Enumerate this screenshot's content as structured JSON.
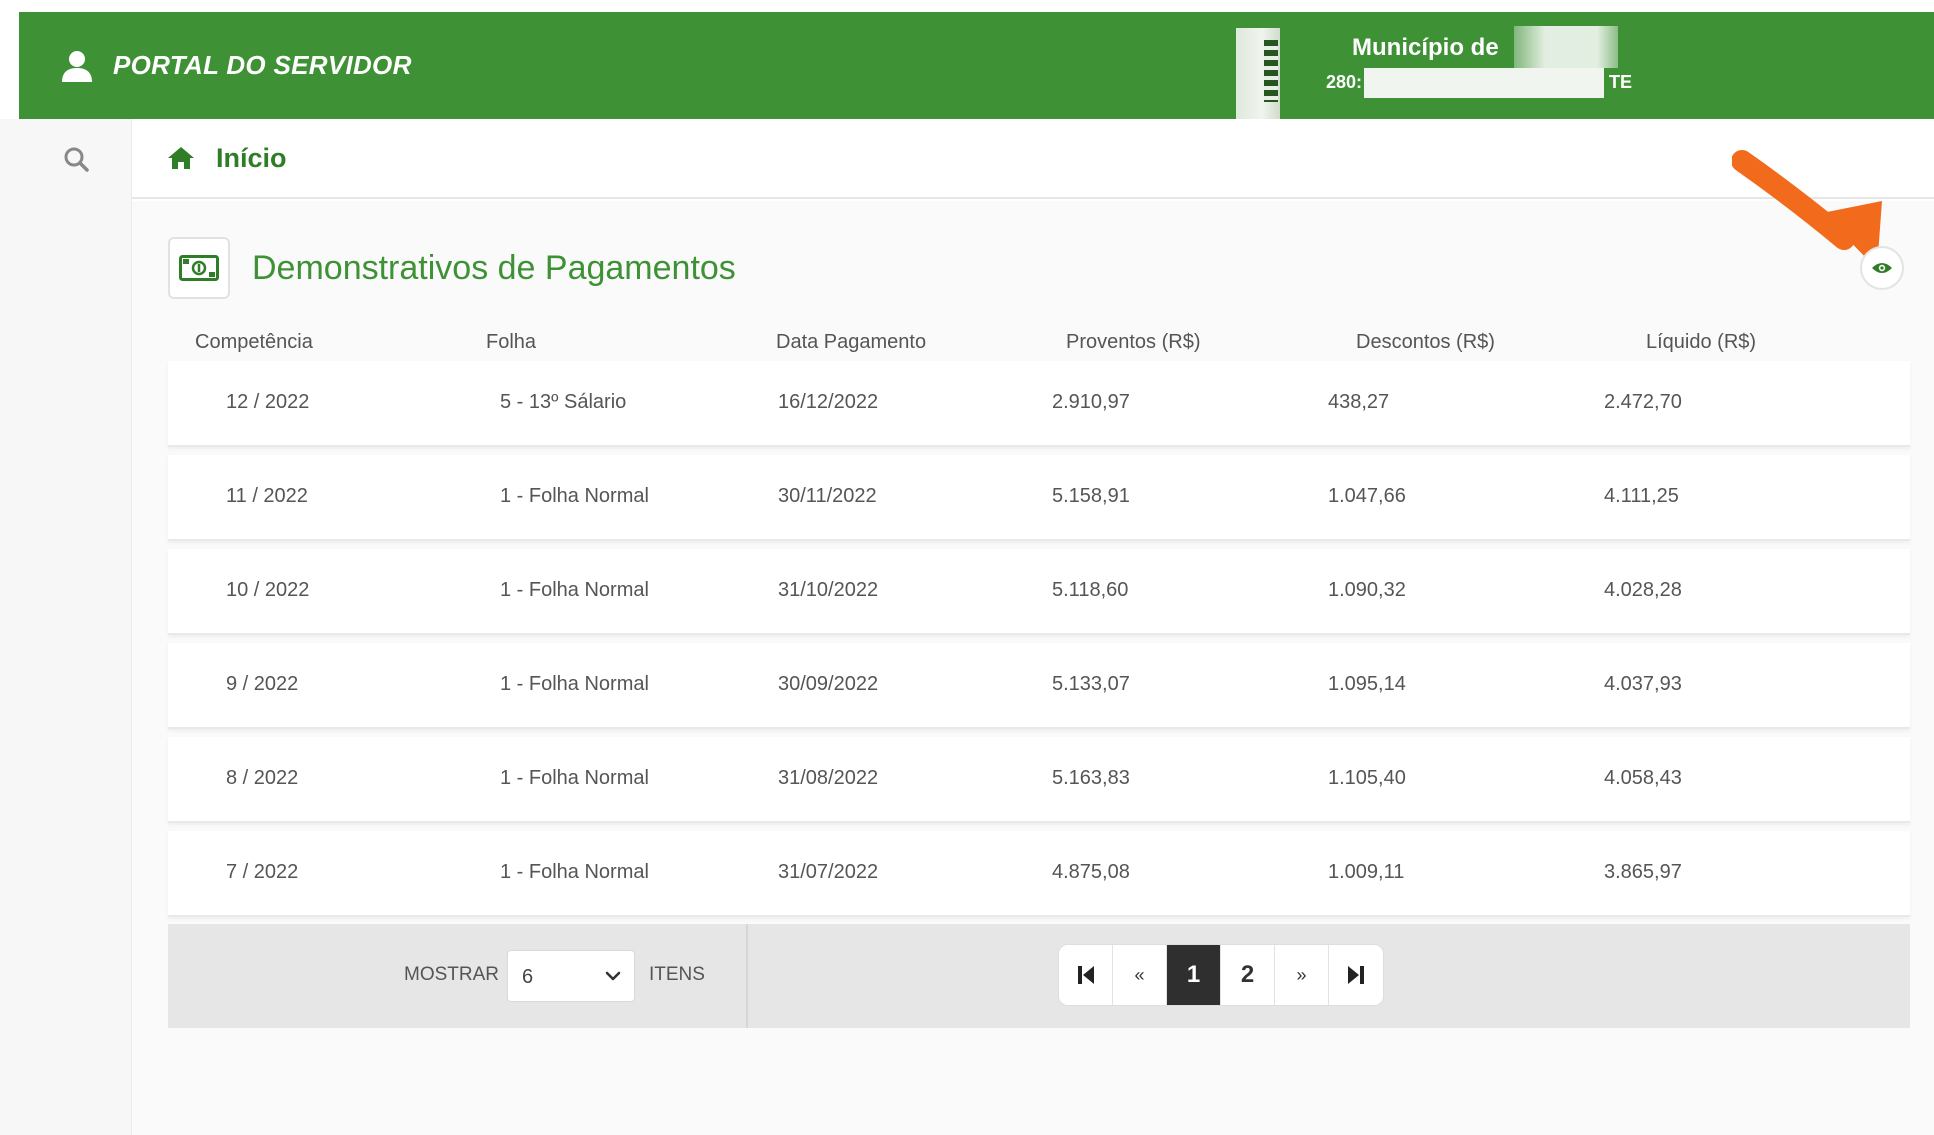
{
  "header": {
    "portal_title": "PORTAL DO SERVIDOR",
    "municipality_name": "Município de",
    "municipality_code_prefix": "280:",
    "municipality_code_suffix": "TE"
  },
  "breadcrumb": {
    "home_label": "Início"
  },
  "panel": {
    "title": "Demonstrativos de Pagamentos"
  },
  "table": {
    "columns": [
      "Competência",
      "Folha",
      "Data Pagamento",
      "Proventos (R$)",
      "Descontos (R$)",
      "Líquido (R$)"
    ],
    "rows": [
      [
        "12 / 2022",
        "5 - 13º Sálario",
        "16/12/2022",
        "2.910,97",
        "438,27",
        "2.472,70"
      ],
      [
        "11 / 2022",
        "1 - Folha Normal",
        "30/11/2022",
        "5.158,91",
        "1.047,66",
        "4.111,25"
      ],
      [
        "10 / 2022",
        "1 - Folha Normal",
        "31/10/2022",
        "5.118,60",
        "1.090,32",
        "4.028,28"
      ],
      [
        "9 / 2022",
        "1 - Folha Normal",
        "30/09/2022",
        "5.133,07",
        "1.095,14",
        "4.037,93"
      ],
      [
        "8 / 2022",
        "1 - Folha Normal",
        "31/08/2022",
        "5.163,83",
        "1.105,40",
        "4.058,43"
      ],
      [
        "7 / 2022",
        "1 - Folha Normal",
        "31/07/2022",
        "4.875,08",
        "1.009,11",
        "3.865,97"
      ]
    ]
  },
  "footer": {
    "show_label": "MOSTRAR",
    "items_selected": "6",
    "items_label": "ITENS",
    "pagination": {
      "prev": "«",
      "next": "»",
      "pages": [
        "1",
        "2"
      ],
      "current": "1"
    }
  },
  "colors": {
    "primary_green": "#3e9135",
    "arrow_orange": "#f26a1b",
    "active_page": "#2f2f2f"
  },
  "icons": [
    "user-icon",
    "search-icon",
    "home-icon",
    "money-icon",
    "eye-icon",
    "first-page-icon",
    "last-page-icon",
    "chevron-down-icon"
  ]
}
